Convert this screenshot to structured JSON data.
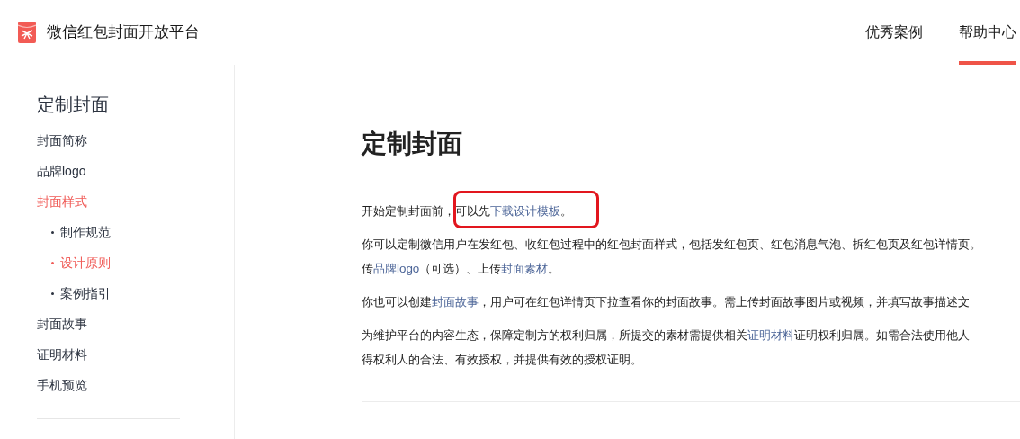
{
  "header": {
    "title": "微信红包封面开放平台",
    "nav": [
      {
        "label": "优秀案例",
        "selected": false
      },
      {
        "label": "帮助中心",
        "selected": true
      }
    ]
  },
  "sidebar": {
    "title": "定制封面",
    "items": [
      {
        "label": "封面简称",
        "selected": false
      },
      {
        "label": "品牌logo",
        "selected": false
      },
      {
        "label": "封面样式",
        "selected": true,
        "children": [
          {
            "label": "制作规范",
            "selected": false
          },
          {
            "label": "设计原则",
            "selected": true
          },
          {
            "label": "案例指引",
            "selected": false
          }
        ]
      },
      {
        "label": "封面故事",
        "selected": false
      },
      {
        "label": "证明材料",
        "selected": false
      },
      {
        "label": "手机预览",
        "selected": false
      }
    ]
  },
  "article": {
    "title": "定制封面",
    "paragraphs": [
      {
        "highlighted": true,
        "lines": [
          [
            {
              "kind": "text",
              "text": "开始定制封面前，可以先"
            },
            {
              "kind": "link",
              "text": "下载设计模板"
            },
            {
              "kind": "text",
              "text": "。"
            }
          ]
        ]
      },
      {
        "highlighted": false,
        "lines": [
          [
            {
              "kind": "text",
              "text": "你可以定制微信用户在发红包、收红包过程中的红包封面样式，包括发红包页、红包消息气泡、拆红包页及红包详情页。"
            }
          ],
          [
            {
              "kind": "text",
              "text": "传"
            },
            {
              "kind": "link",
              "text": "品牌logo"
            },
            {
              "kind": "text",
              "text": "（可选）、上传"
            },
            {
              "kind": "link",
              "text": "封面素材"
            },
            {
              "kind": "text",
              "text": "。"
            }
          ]
        ]
      },
      {
        "highlighted": false,
        "lines": [
          [
            {
              "kind": "text",
              "text": "你也可以创建"
            },
            {
              "kind": "link",
              "text": "封面故事"
            },
            {
              "kind": "text",
              "text": "，用户可在红包详情页下拉查看你的封面故事。需上传封面故事图片或视频，并填写故事描述文"
            }
          ]
        ]
      },
      {
        "highlighted": false,
        "lines": [
          [
            {
              "kind": "text",
              "text": "为维护平台的内容生态，保障定制方的权利归属，所提交的素材需提供相关"
            },
            {
              "kind": "link",
              "text": "证明材料"
            },
            {
              "kind": "text",
              "text": "证明权利归属。如需合法使用他人"
            }
          ],
          [
            {
              "kind": "text",
              "text": "得权利人的合法、有效授权，并提供有效的授权证明。"
            }
          ]
        ]
      }
    ]
  }
}
